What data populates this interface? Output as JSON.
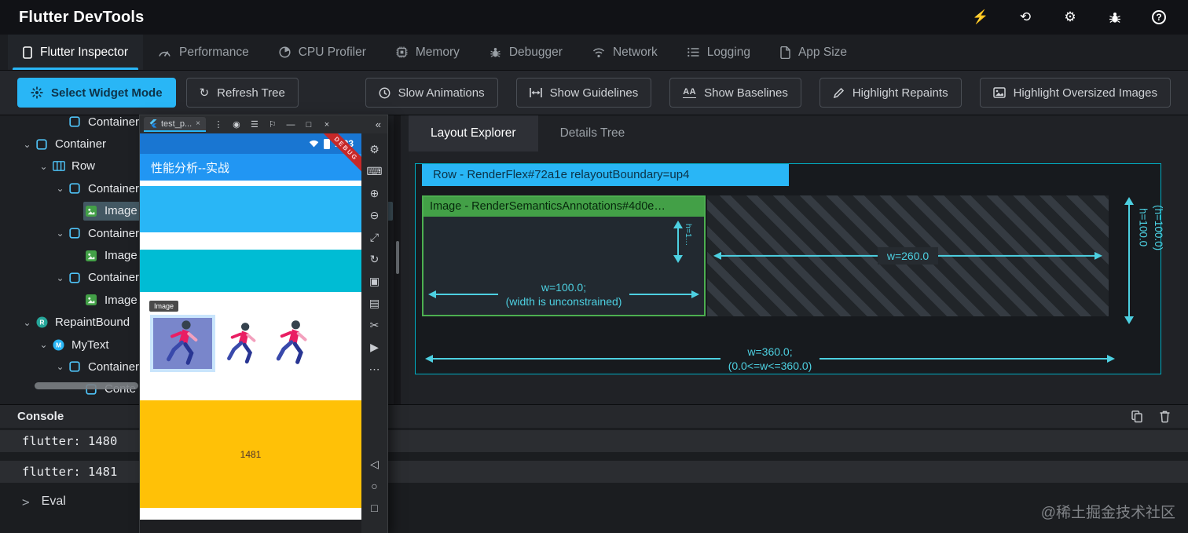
{
  "colors": {
    "accent": "#29b6f6",
    "flex_border": "#00acc1",
    "annotation_teal": "#4dd0e1",
    "row_chip_bg": "#29b6f6",
    "image_chip_bg": "#43a047",
    "green_border": "#4caf50",
    "appbar_blue": "#2196f3",
    "block_blue": "#29b6f6",
    "block_cyan": "#00bcd4",
    "block_yellow": "#ffc107",
    "debug_red": "#c62828"
  },
  "titlebar": {
    "title": "Flutter DevTools",
    "icons": [
      "flash-icon",
      "history-icon",
      "settings-icon",
      "bug-report-icon",
      "help-icon"
    ]
  },
  "tabs": {
    "items": [
      {
        "id": "flutter-inspector",
        "label": "Flutter Inspector",
        "icon": "inspector-tab-icon",
        "active": true
      },
      {
        "id": "performance",
        "label": "Performance",
        "icon": "performance-tab-icon",
        "active": false
      },
      {
        "id": "cpu-profiler",
        "label": "CPU Profiler",
        "icon": "cpu-tab-icon",
        "active": false
      },
      {
        "id": "memory",
        "label": "Memory",
        "icon": "memory-tab-icon",
        "active": false
      },
      {
        "id": "debugger",
        "label": "Debugger",
        "icon": "debugger-tab-icon",
        "active": false
      },
      {
        "id": "network",
        "label": "Network",
        "icon": "network-tab-icon",
        "active": false
      },
      {
        "id": "logging",
        "label": "Logging",
        "icon": "logging-tab-icon",
        "active": false
      },
      {
        "id": "app-size",
        "label": "App Size",
        "icon": "appsize-tab-icon",
        "active": false
      }
    ]
  },
  "toolbar": {
    "select_widget_mode": {
      "label": "Select Widget Mode",
      "icon": "select-widget-mode-icon"
    },
    "refresh_tree": {
      "label": "Refresh Tree",
      "icon": "refresh-icon"
    },
    "toggles": [
      {
        "id": "slow-animations",
        "label": "Slow Animations",
        "icon": "slow-animations-icon"
      },
      {
        "id": "show-guidelines",
        "label": "Show Guidelines",
        "icon": "show-guidelines-icon"
      },
      {
        "id": "show-baselines",
        "label": "Show Baselines",
        "icon": "show-baselines-icon"
      },
      {
        "id": "highlight-repaints",
        "label": "Highlight Repaints",
        "icon": "highlight-repaints-icon"
      },
      {
        "id": "highlight-oversized-images",
        "label": "Highlight Oversized Images",
        "icon": "highlight-oversized-icon"
      }
    ]
  },
  "widget_tree": {
    "items": [
      {
        "id": "container-0",
        "label": "Container",
        "icon": "container",
        "depth": 2,
        "chevron": false,
        "selected": false
      },
      {
        "id": "container-1",
        "label": "Container",
        "icon": "container",
        "depth": 0,
        "chevron": true,
        "selected": false
      },
      {
        "id": "row-1",
        "label": "Row",
        "icon": "row",
        "depth": 1,
        "chevron": true,
        "selected": false
      },
      {
        "id": "container-2",
        "label": "Container",
        "icon": "container",
        "depth": 2,
        "chevron": true,
        "selected": false
      },
      {
        "id": "image-1",
        "label": "Image",
        "icon": "image",
        "depth": 3,
        "chevron": false,
        "selected": true
      },
      {
        "id": "container-3",
        "label": "Container",
        "icon": "container",
        "depth": 2,
        "chevron": true,
        "selected": false
      },
      {
        "id": "image-2",
        "label": "Image",
        "icon": "image",
        "depth": 3,
        "chevron": false,
        "selected": false
      },
      {
        "id": "container-4",
        "label": "Container",
        "icon": "container",
        "depth": 2,
        "chevron": true,
        "selected": false
      },
      {
        "id": "image-3",
        "label": "Image",
        "icon": "image",
        "depth": 3,
        "chevron": false,
        "selected": false
      },
      {
        "id": "repaintboundary",
        "label": "RepaintBound",
        "icon": "repaintboundary",
        "depth": 0,
        "chevron": true,
        "selected": false
      },
      {
        "id": "mytext",
        "label": "MyText",
        "icon": "mytext",
        "depth": 1,
        "chevron": true,
        "selected": false
      },
      {
        "id": "container-5",
        "label": "Container",
        "icon": "container",
        "depth": 2,
        "chevron": true,
        "selected": false
      },
      {
        "id": "container-6",
        "label": "Conte",
        "icon": "container",
        "depth": 3,
        "chevron": false,
        "selected": false
      }
    ]
  },
  "layout_explorer": {
    "tabs": [
      {
        "id": "layout-explorer",
        "label": "Layout Explorer",
        "active": true
      },
      {
        "id": "details-tree",
        "label": "Details Tree",
        "active": false
      }
    ],
    "row_chip": "Row - RenderFlex#72a1e relayoutBoundary=up4",
    "image_chip": "Image - RenderSemanticsAnnotations#4d0e…",
    "image_width_line1": "w=100.0;",
    "image_width_line2": "(width is unconstrained)",
    "image_height_small": "h=1…",
    "free_space_width": "w=260.0",
    "total_height_line1": "h=100.0",
    "total_height_line2": "(h=100.0)",
    "total_width_line1": "w=360.0;",
    "total_width_line2": "(0.0<=w<=360.0)"
  },
  "console": {
    "title": "Console",
    "lines": [
      "flutter: 1480",
      "flutter: 1481"
    ],
    "prompt_chevron": ">",
    "prompt_label": "Eval"
  },
  "emulator": {
    "tab_label": "test_p...",
    "titlebar_icons": [
      "more-vertical-icon",
      "record-icon",
      "menu-icon",
      "pin-icon",
      "minimize-icon",
      "maximize-icon",
      "close-icon"
    ],
    "side_icons_top": [
      "device-settings-icon",
      "keyboard-icon",
      "volume-up-icon",
      "volume-down-icon",
      "fullscreen-icon",
      "rotate-icon",
      "screenshot-icon",
      "gallery-icon",
      "snip-icon",
      "record-video-icon",
      "more-icon"
    ],
    "side_icons_bottom": [
      "back-icon",
      "home-icon",
      "overview-icon"
    ],
    "status_time": "1:23",
    "debug_banner": "DEBUG",
    "app_title": "性能分析--实战",
    "image_tooltip": "Image",
    "yellow_block_text": "1481"
  },
  "watermark": "@稀土掘金技术社区"
}
